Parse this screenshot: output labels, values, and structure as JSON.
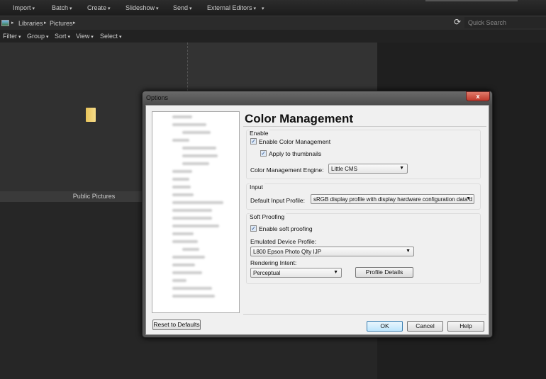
{
  "menubar": {
    "items": [
      "Import",
      "Batch",
      "Create",
      "Slideshow",
      "Send",
      "External Editors"
    ]
  },
  "breadcrumb": {
    "items": [
      "Libraries",
      "Pictures"
    ]
  },
  "search": {
    "placeholder": "Quick Search"
  },
  "filterbar": {
    "items": [
      "Filter",
      "Group",
      "Sort",
      "View",
      "Select"
    ]
  },
  "folder": {
    "label": "Public Pictures",
    "icon": "folder-icon"
  },
  "dialog": {
    "title": "Options",
    "heading": "Color Management",
    "enable": {
      "label": "Enable",
      "enable_cm": "Enable Color Management",
      "enable_cm_checked": true,
      "apply_thumbs": "Apply to thumbnails",
      "apply_thumbs_checked": true,
      "engine_label": "Color Management Engine:",
      "engine_value": "Little CMS"
    },
    "input": {
      "label": "Input",
      "profile_label": "Default Input Profile:",
      "profile_value": "sRGB display profile with display hardware configuration data d"
    },
    "soft": {
      "label": "Soft Proofing",
      "enable_label": "Enable soft proofing",
      "enable_checked": true,
      "device_label": "Emulated Device Profile:",
      "device_value": "L800 Epson Photo Qlty IJP",
      "intent_label": "Rendering Intent:",
      "intent_value": "Perceptual",
      "details_button": "Profile Details"
    },
    "buttons": {
      "reset": "Reset to Defaults",
      "ok": "OK",
      "cancel": "Cancel",
      "help": "Help"
    },
    "close": "x"
  },
  "colors": {
    "close_red": "#c0392b",
    "ok_focus": "#5fa8e0"
  }
}
